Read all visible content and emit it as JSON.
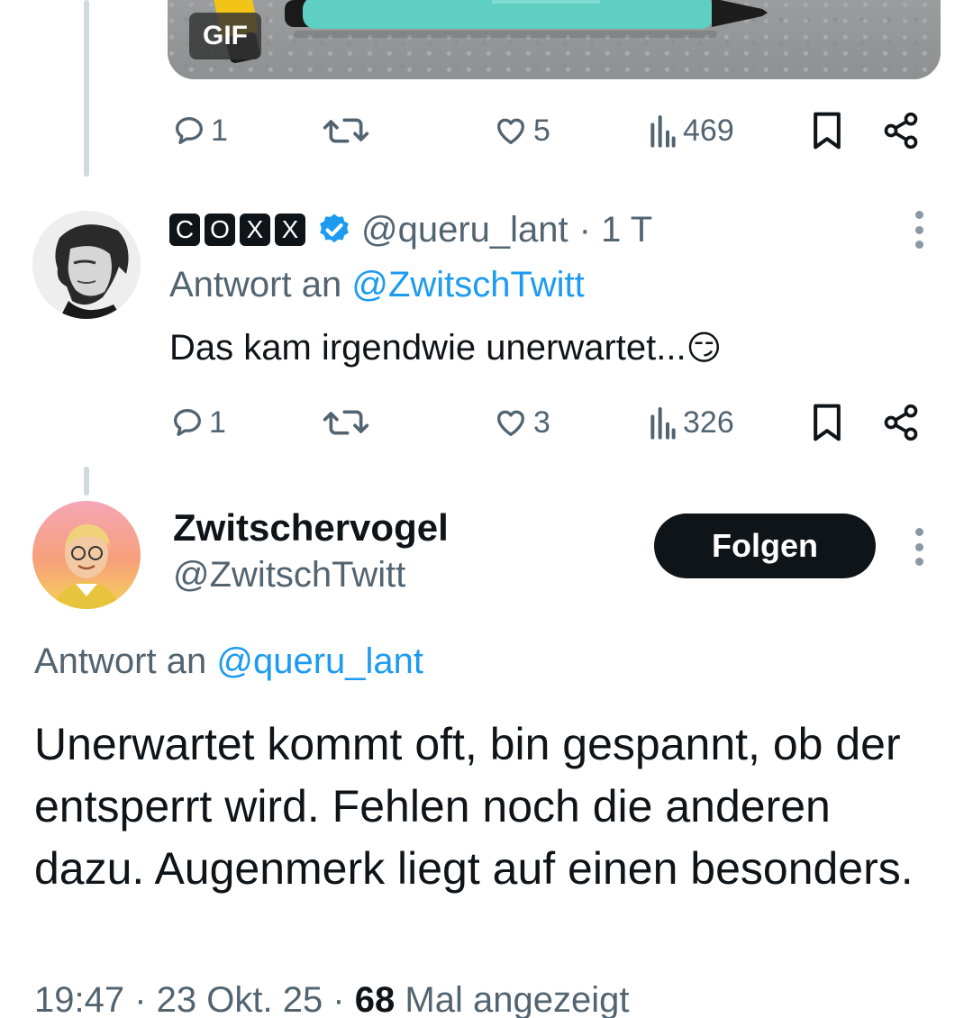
{
  "top_tweet": {
    "media_badge": "GIF",
    "actions": {
      "replies": "1",
      "likes": "5",
      "views": "469"
    }
  },
  "reply_tweet": {
    "badge_letters": [
      "C",
      "O",
      "X",
      "X"
    ],
    "handle": "@queru_lant",
    "time": "· 1 T",
    "reply_prefix": "Antwort an",
    "reply_mention": "@ZwitschTwitt",
    "text": "Das kam irgendwie unerwartet...",
    "emoji": "😏",
    "actions": {
      "replies": "1",
      "likes": "3",
      "views": "326"
    }
  },
  "main_tweet": {
    "display_name": "Zwitschervogel",
    "handle": "@ZwitschTwitt",
    "follow_label": "Folgen",
    "reply_prefix": "Antwort an",
    "reply_mention": "@queru_lant",
    "text": "Unerwartet kommt oft, bin gespannt, ob der entsperrt wird. Fehlen noch die anderen dazu. Augenmerk liegt auf einen besonders.",
    "timestamp": "19:47 · 23 Okt. 25 ·",
    "view_count": "68",
    "view_suffix": "Mal angezeigt"
  },
  "colors": {
    "accent": "#1d9bf0",
    "muted": "#536471",
    "text": "#0f1419",
    "thread_line": "#cfd9de"
  }
}
